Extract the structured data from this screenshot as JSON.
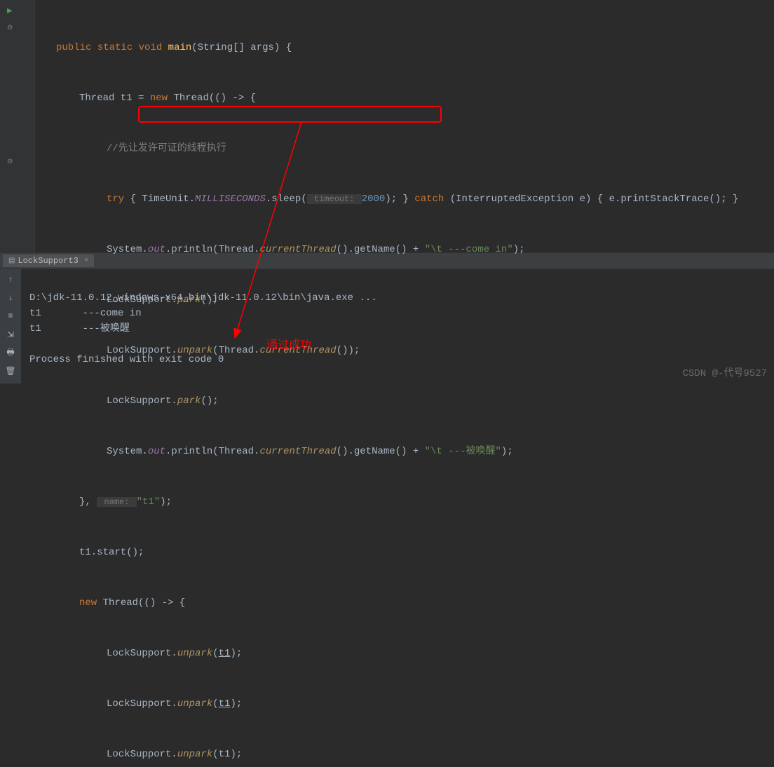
{
  "code": {
    "l1": {
      "public": "public",
      "static": "static",
      "void": "void",
      "main": "main",
      "params": "(String[] args) {"
    },
    "l2": {
      "a": "Thread t1 = ",
      "new": "new",
      "b": " Thread(() -> {"
    },
    "l3": {
      "comment": "//先让发许可证的线程执行"
    },
    "l4": {
      "try": "try",
      "a": " { TimeUnit.",
      "ms": "MILLISECONDS",
      "b": ".sleep(",
      "hint": " timeout: ",
      "num": "2000",
      "c": "); } ",
      "catch": "catch",
      "d": " (InterruptedException e) { e.printStackTrace(); }"
    },
    "l5": {
      "a": "System.",
      "out": "out",
      "b": ".println(Thread.",
      "ct": "currentThread",
      "c": "().getName() + ",
      "str": "\"\\t ---come in\"",
      "d": ");"
    },
    "l6": {
      "a": "LockSupport.",
      "park": "park",
      "b": "();"
    },
    "l7": {
      "a": "LockSupport.",
      "unpark": "unpark",
      "b": "(Thread.",
      "ct": "currentThread",
      "c": "());"
    },
    "l8": {
      "a": "LockSupport.",
      "park": "park",
      "b": "();"
    },
    "l9": {
      "a": "System.",
      "out": "out",
      "b": ".println(Thread.",
      "ct": "currentThread",
      "c": "().getName() + ",
      "str": "\"\\t ---被唤醒\"",
      "d": ");"
    },
    "l10": {
      "a": "}, ",
      "hint": " name: ",
      "str": "\"t1\"",
      "b": ");"
    },
    "l11": {
      "a": "t1.start();"
    },
    "l12": {
      "new": "new",
      "a": " Thread(() -> {"
    },
    "l13": {
      "a": "LockSupport.",
      "unpark": "unpark",
      "b": "(",
      "t1": "t1",
      "c": ");"
    },
    "l14": {
      "a": "LockSupport.",
      "unpark": "unpark",
      "b": "(",
      "t1": "t1",
      "c": ");"
    },
    "l15": {
      "a": "LockSupport.",
      "unpark": "unpark",
      "b": "(t1);"
    }
  },
  "tab": {
    "name": "LockSupport3"
  },
  "console": {
    "line1": "D:\\jdk-11.0.12_windows-x64_bin\\jdk-11.0.12\\bin\\java.exe ...",
    "line2": "t1\t ---come in",
    "line3": "t1\t ---被唤醒",
    "line4": "Process finished with exit code 0"
  },
  "annotation": "通过成功",
  "watermark": "CSDN @-代号9527"
}
